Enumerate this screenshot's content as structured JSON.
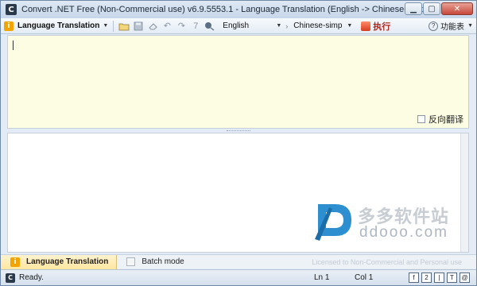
{
  "window": {
    "title": "Convert .NET Free (Non-Commercial use) v6.9.5553.1 - Language Translation (English -> Chinese-simp)",
    "app_icon_glyph": "C",
    "controls": {
      "minimize": "▁",
      "maximize": "▢",
      "close": "✕"
    }
  },
  "toolbar": {
    "mode_label": "Language Translation",
    "info_glyph": "i",
    "source_language": "English",
    "target_language": "Chinese-simp",
    "run_label": "执行",
    "features_label": "功能表",
    "features_glyph": "?",
    "icons": [
      "open-folder-icon",
      "save-icon",
      "eraser-icon",
      "undo-icon",
      "redo-icon",
      "paste-icon",
      "translate-icon"
    ]
  },
  "editor_top": {
    "reverse_label": "反向翻译",
    "reverse_checked": false
  },
  "watermark": {
    "cn": "多多软件站",
    "en": "ddooo.com"
  },
  "mode_tabs": {
    "tab1": "Language Translation",
    "tab2": "Batch mode",
    "license": "Licensed to Non-Commercial and Personal use"
  },
  "statusbar": {
    "status": "Ready.",
    "ln": "Ln 1",
    "col": "Col 1",
    "tools": [
      "f",
      "2",
      "|",
      "T",
      "@"
    ]
  },
  "colors": {
    "accent_orange": "#f2a400",
    "run_red": "#b3261e",
    "editor_bg": "#fdfde4"
  }
}
